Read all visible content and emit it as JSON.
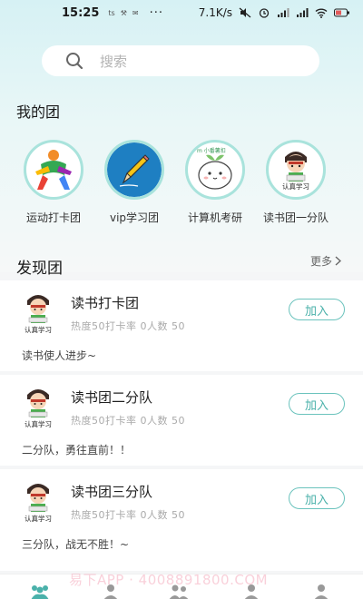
{
  "status_bar": {
    "time": "15:25",
    "mini_icons": [
      "ts",
      "⚒",
      "✉"
    ],
    "dots": "···",
    "speed": "7.1K/s"
  },
  "search": {
    "placeholder": "搜索"
  },
  "my_groups": {
    "title": "我的团",
    "items": [
      {
        "label": "运动打卡团",
        "icon": "sports-figure-icon"
      },
      {
        "label": "vip学习团",
        "icon": "pencil-icon"
      },
      {
        "label": "计算机考研",
        "icon": "sprout-mascot-icon",
        "image_text": "m 小番薯扣"
      },
      {
        "label": "读书团一分队",
        "icon": "student-cartoon-icon",
        "image_text": "认真学习"
      }
    ]
  },
  "discover": {
    "title": "发现团",
    "more_label": "更多",
    "join_label": "加入",
    "avatar_caption": "认真学习",
    "groups": [
      {
        "name": "读书打卡团",
        "stats": "热度50打卡率 0人数 50",
        "description": "读书使人进步~"
      },
      {
        "name": "读书团二分队",
        "stats": "热度50打卡率 0人数 50",
        "description": "二分队，勇往直前！！"
      },
      {
        "name": "读书团三分队",
        "stats": "热度50打卡率 0人数 50",
        "description": "三分队，战无不胜！~"
      }
    ]
  },
  "watermark": "易下APP · 4008891800.COM",
  "colors": {
    "accent": "#4ab1aa",
    "ring": "#a9e3dc",
    "bg_top": "#d6f1f4"
  }
}
